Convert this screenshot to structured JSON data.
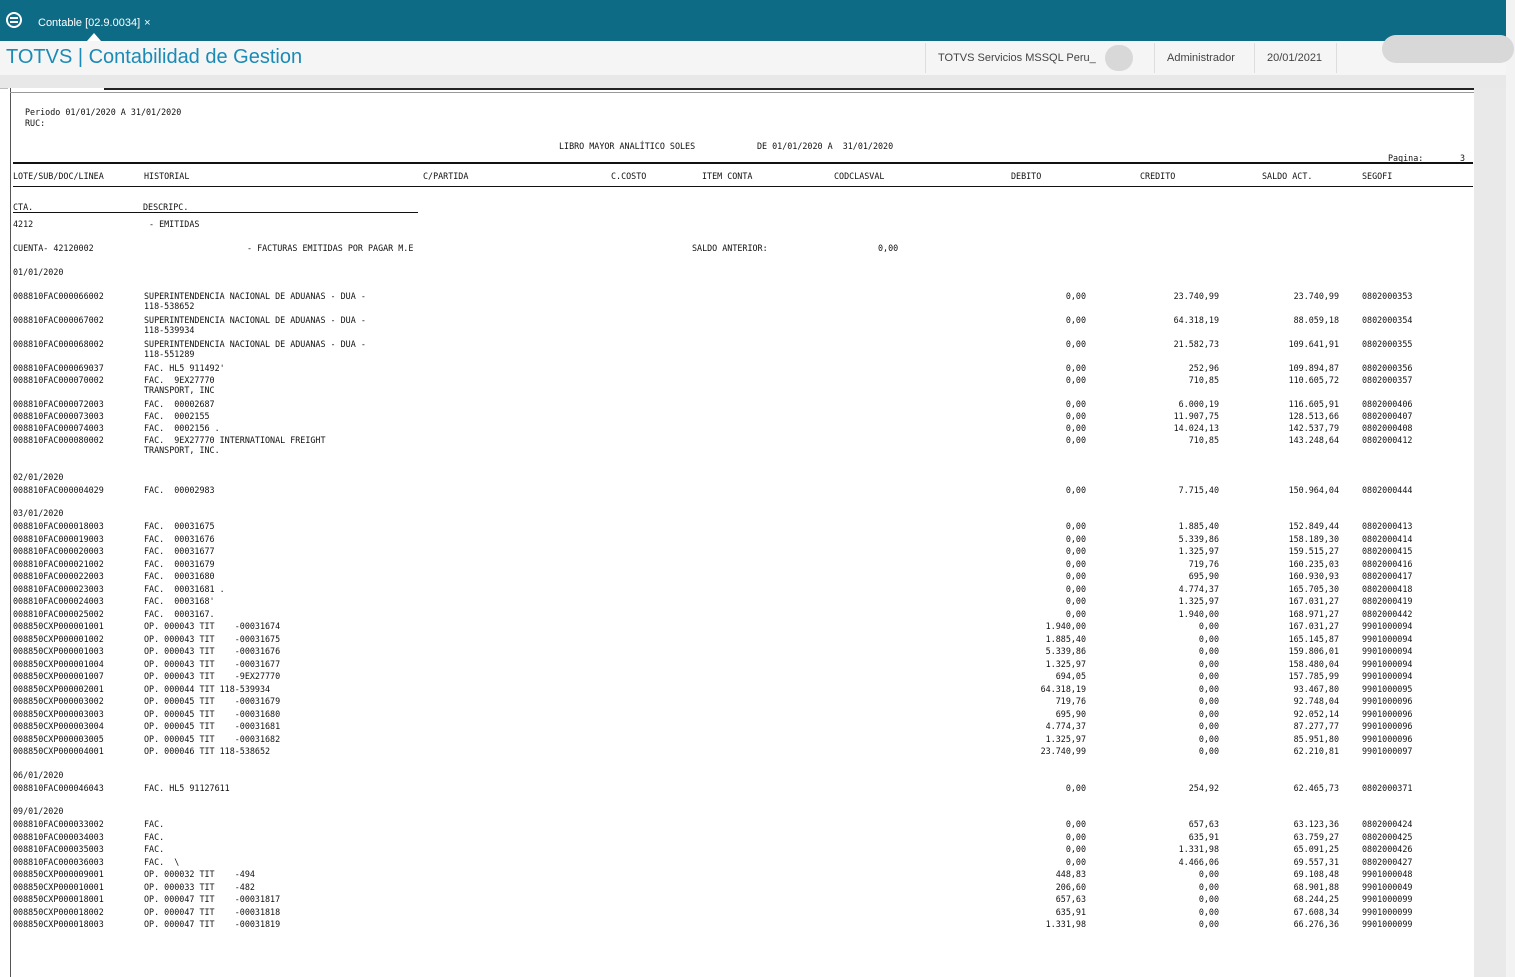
{
  "window": {
    "tab_label": "Contable [02.9.0034]",
    "tab_close": "×",
    "app_title": "TOTVS | Contabilidad de Gestion",
    "company": "TOTVS Servicios MSSQL Peru_",
    "user": "Administrador",
    "date": "20/01/2021"
  },
  "report": {
    "periodo": "Periodo 01/01/2020 A 31/01/2020",
    "ruc": "RUC:",
    "title": "LIBRO MAYOR ANALÍTICO SOLES",
    "range": "DE 01/01/2020 A  31/01/2020",
    "page_label": "Pagina:",
    "page_num": "3",
    "columns": [
      "LOTE/SUB/DOC/LINEA",
      "HISTORIAL",
      "C/PARTIDA",
      "C.COSTO",
      "ITEM CONTA",
      "CODCLASVAL",
      "DEBITO",
      "CREDITO",
      "SALDO ACT.",
      "SEGOFI"
    ],
    "cta_label": "CTA.",
    "descripc_label": "DESCRIPC.",
    "cta_code": "4212",
    "cta_desc": "- EMITIDAS",
    "cuenta": "CUENTA- 42120002",
    "cuenta_desc": "- FACTURAS EMITIDAS POR PAGAR M.E",
    "saldo_anterior_label": "SALDO ANTERIOR:",
    "saldo_anterior": "0,00",
    "groups": [
      {
        "date": "01/01/2020",
        "rows": [
          {
            "doc": "008810FAC000066002",
            "hist": "SUPERINTENDENCIA NACIONAL DE ADUANAS - DUA -",
            "hist2": "118-538652",
            "deb": "0,00",
            "cred": "23.740,99",
            "saldo": "23.740,99",
            "seg": "0802000353"
          },
          {
            "doc": "008810FAC000067002",
            "hist": "SUPERINTENDENCIA NACIONAL DE ADUANAS - DUA -",
            "hist2": "118-539934",
            "deb": "0,00",
            "cred": "64.318,19",
            "saldo": "88.059,18",
            "seg": "0802000354"
          },
          {
            "doc": "008810FAC000068002",
            "hist": "SUPERINTENDENCIA NACIONAL DE ADUANAS - DUA -",
            "hist2": "118-551289",
            "deb": "0,00",
            "cred": "21.582,73",
            "saldo": "109.641,91",
            "seg": "0802000355"
          },
          {
            "doc": "008810FAC000069037",
            "hist": "FAC. HL5 911492'",
            "deb": "0,00",
            "cred": "252,96",
            "saldo": "109.894,87",
            "seg": "0802000356"
          },
          {
            "doc": "008810FAC000070002",
            "hist": "FAC.  9EX27770",
            "hist2": "TRANSPORT, INC",
            "deb": "0,00",
            "cred": "710,85",
            "saldo": "110.605,72",
            "seg": "0802000357"
          },
          {
            "doc": "008810FAC000072003",
            "hist": "FAC.  00002687",
            "deb": "0,00",
            "cred": "6.000,19",
            "saldo": "116.605,91",
            "seg": "0802000406"
          },
          {
            "doc": "008810FAC000073003",
            "hist": "FAC.  0002155",
            "deb": "0,00",
            "cred": "11.907,75",
            "saldo": "128.513,66",
            "seg": "0802000407"
          },
          {
            "doc": "008810FAC000074003",
            "hist": "FAC.  0002156 .",
            "deb": "0,00",
            "cred": "14.024,13",
            "saldo": "142.537,79",
            "seg": "0802000408"
          },
          {
            "doc": "008810FAC000080002",
            "hist": "FAC.  9EX27770 INTERNATIONAL FREIGHT",
            "hist2": "TRANSPORT, INC.",
            "deb": "0,00",
            "cred": "710,85",
            "saldo": "143.248,64",
            "seg": "0802000412"
          }
        ]
      },
      {
        "date": "02/01/2020",
        "rows": [
          {
            "doc": "008810FAC000004029",
            "hist": "FAC.  00002983",
            "deb": "0,00",
            "cred": "7.715,40",
            "saldo": "150.964,04",
            "seg": "0802000444"
          }
        ]
      },
      {
        "date": "03/01/2020",
        "rows": [
          {
            "doc": "008810FAC000018003",
            "hist": "FAC.  00031675",
            "deb": "0,00",
            "cred": "1.885,40",
            "saldo": "152.849,44",
            "seg": "0802000413"
          },
          {
            "doc": "008810FAC000019003",
            "hist": "FAC.  00031676",
            "deb": "0,00",
            "cred": "5.339,86",
            "saldo": "158.189,30",
            "seg": "0802000414"
          },
          {
            "doc": "008810FAC000020003",
            "hist": "FAC.  00031677",
            "deb": "0,00",
            "cred": "1.325,97",
            "saldo": "159.515,27",
            "seg": "0802000415"
          },
          {
            "doc": "008810FAC000021002",
            "hist": "FAC.  00031679",
            "deb": "0,00",
            "cred": "719,76",
            "saldo": "160.235,03",
            "seg": "0802000416"
          },
          {
            "doc": "008810FAC000022003",
            "hist": "FAC.  00031680",
            "deb": "0,00",
            "cred": "695,90",
            "saldo": "160.930,93",
            "seg": "0802000417"
          },
          {
            "doc": "008810FAC000023003",
            "hist": "FAC.  00031681 .",
            "deb": "0,00",
            "cred": "4.774,37",
            "saldo": "165.705,30",
            "seg": "0802000418"
          },
          {
            "doc": "008810FAC000024003",
            "hist": "FAC.  0003168'",
            "deb": "0,00",
            "cred": "1.325,97",
            "saldo": "167.031,27",
            "seg": "0802000419"
          },
          {
            "doc": "008810FAC000025002",
            "hist": "FAC.  0003167.",
            "deb": "0,00",
            "cred": "1.940,00",
            "saldo": "168.971,27",
            "seg": "0802000442"
          },
          {
            "doc": "008850CXP000001001",
            "hist": "OP. 000043 TIT    -00031674",
            "deb": "1.940,00",
            "cred": "0,00",
            "saldo": "167.031,27",
            "seg": "9901000094"
          },
          {
            "doc": "008850CXP000001002",
            "hist": "OP. 000043 TIT    -00031675",
            "deb": "1.885,40",
            "cred": "0,00",
            "saldo": "165.145,87",
            "seg": "9901000094"
          },
          {
            "doc": "008850CXP000001003",
            "hist": "OP. 000043 TIT    -00031676",
            "deb": "5.339,86",
            "cred": "0,00",
            "saldo": "159.806,01",
            "seg": "9901000094"
          },
          {
            "doc": "008850CXP000001004",
            "hist": "OP. 000043 TIT    -00031677",
            "deb": "1.325,97",
            "cred": "0,00",
            "saldo": "158.480,04",
            "seg": "9901000094"
          },
          {
            "doc": "008850CXP000001007",
            "hist": "OP. 000043 TIT    -9EX27770",
            "deb": "694,05",
            "cred": "0,00",
            "saldo": "157.785,99",
            "seg": "9901000094"
          },
          {
            "doc": "008850CXP000002001",
            "hist": "OP. 000044 TIT 118-539934",
            "deb": "64.318,19",
            "cred": "0,00",
            "saldo": "93.467,80",
            "seg": "9901000095"
          },
          {
            "doc": "008850CXP000003002",
            "hist": "OP. 000045 TIT    -00031679",
            "deb": "719,76",
            "cred": "0,00",
            "saldo": "92.748,04",
            "seg": "9901000096"
          },
          {
            "doc": "008850CXP000003003",
            "hist": "OP. 000045 TIT    -00031680",
            "deb": "695,90",
            "cred": "0,00",
            "saldo": "92.052,14",
            "seg": "9901000096"
          },
          {
            "doc": "008850CXP000003004",
            "hist": "OP. 000045 TIT    -00031681",
            "deb": "4.774,37",
            "cred": "0,00",
            "saldo": "87.277,77",
            "seg": "9901000096"
          },
          {
            "doc": "008850CXP000003005",
            "hist": "OP. 000045 TIT    -00031682",
            "deb": "1.325,97",
            "cred": "0,00",
            "saldo": "85.951,80",
            "seg": "9901000096"
          },
          {
            "doc": "008850CXP000004001",
            "hist": "OP. 000046 TIT 118-538652",
            "deb": "23.740,99",
            "cred": "0,00",
            "saldo": "62.210,81",
            "seg": "9901000097"
          }
        ]
      },
      {
        "date": "06/01/2020",
        "rows": [
          {
            "doc": "008810FAC000046043",
            "hist": "FAC. HL5 91127611",
            "deb": "0,00",
            "cred": "254,92",
            "saldo": "62.465,73",
            "seg": "0802000371"
          }
        ]
      },
      {
        "date": "09/01/2020",
        "rows": [
          {
            "doc": "008810FAC000033002",
            "hist": "FAC.",
            "deb": "0,00",
            "cred": "657,63",
            "saldo": "63.123,36",
            "seg": "0802000424"
          },
          {
            "doc": "008810FAC000034003",
            "hist": "FAC.",
            "deb": "0,00",
            "cred": "635,91",
            "saldo": "63.759,27",
            "seg": "0802000425"
          },
          {
            "doc": "008810FAC000035003",
            "hist": "FAC.",
            "deb": "0,00",
            "cred": "1.331,98",
            "saldo": "65.091,25",
            "seg": "0802000426"
          },
          {
            "doc": "008810FAC000036003",
            "hist": "FAC.  \\",
            "deb": "0,00",
            "cred": "4.466,06",
            "saldo": "69.557,31",
            "seg": "0802000427"
          },
          {
            "doc": "008850CXP000009001",
            "hist": "OP. 000032 TIT    -494",
            "deb": "448,83",
            "cred": "0,00",
            "saldo": "69.108,48",
            "seg": "9901000048"
          },
          {
            "doc": "008850CXP000010001",
            "hist": "OP. 000033 TIT    -482",
            "deb": "206,60",
            "cred": "0,00",
            "saldo": "68.901,88",
            "seg": "9901000049"
          },
          {
            "doc": "008850CXP000018001",
            "hist": "OP. 000047 TIT    -00031817",
            "deb": "657,63",
            "cred": "0,00",
            "saldo": "68.244,25",
            "seg": "9901000099"
          },
          {
            "doc": "008850CXP000018002",
            "hist": "OP. 000047 TIT    -00031818",
            "deb": "635,91",
            "cred": "0,00",
            "saldo": "67.608,34",
            "seg": "9901000099"
          },
          {
            "doc": "008850CXP000018003",
            "hist": "OP. 000047 TIT    -00031819",
            "deb": "1.331,98",
            "cred": "0,00",
            "saldo": "66.276,36",
            "seg": "9901000099"
          }
        ]
      }
    ]
  }
}
